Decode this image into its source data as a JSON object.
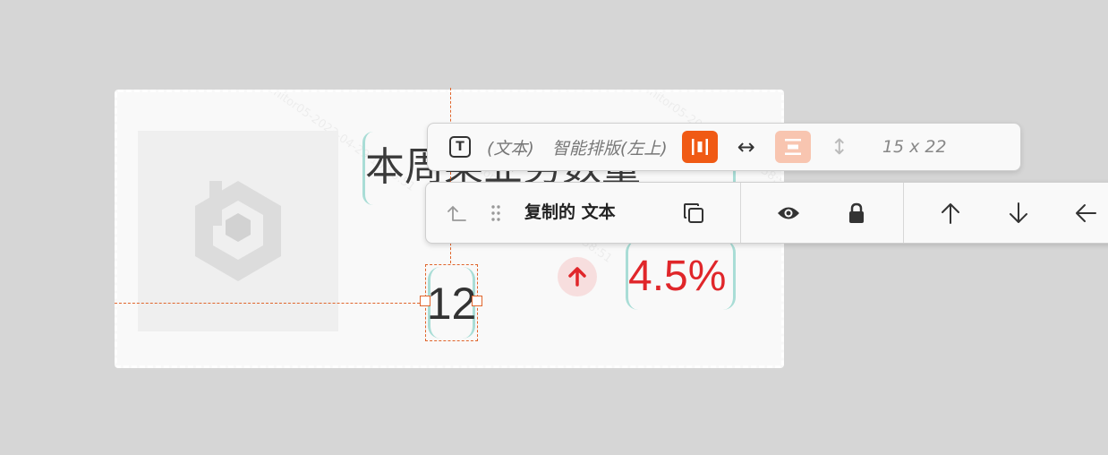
{
  "card": {
    "title": "本周某业务数量",
    "value": "12",
    "percent": "4.5%",
    "trend": "up",
    "image_placeholder_icon": "logo-hexagon-icon",
    "watermark": "monitor05-2023-04-29 10:58:51"
  },
  "info_toolbar": {
    "type_icon": "T",
    "type_label": "(文本)",
    "layout_label": "智能排版(左上)",
    "size": "15 x 22"
  },
  "action_toolbar": {
    "layer_name": "复制的 文本",
    "icons": [
      "return-up-icon",
      "drag-handle-icon",
      "copy-icon",
      "eye-icon",
      "lock-icon",
      "arrow-up-icon",
      "arrow-down-icon",
      "arrow-left-icon"
    ]
  },
  "colors": {
    "accent": "#f05a14",
    "accent_soft": "#f8c5b0",
    "guide": "#e0652b",
    "bracket": "#a9ddd6",
    "up": "#e0262a"
  }
}
